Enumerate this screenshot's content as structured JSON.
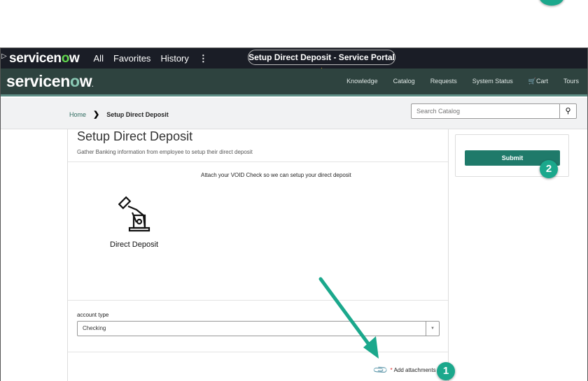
{
  "topbar": {
    "logo": "servicenow",
    "nav": [
      "All",
      "Favorites",
      "History"
    ],
    "more_icon": "vertical-dots-icon",
    "tab_title": "Setup Direct Deposit - Service Portal",
    "star_icon": "star-icon"
  },
  "portal_header": {
    "logo": "servicenow",
    "nav": [
      "Knowledge",
      "Catalog",
      "Requests",
      "System Status",
      "Cart",
      "Tours"
    ],
    "cart_icon": "cart-icon"
  },
  "breadcrumb": {
    "home": "Home",
    "current": "Setup Direct Deposit"
  },
  "search": {
    "placeholder": "Search Catalog",
    "icon": "search-icon"
  },
  "form": {
    "title": "Setup Direct Deposit",
    "description": "Gather Banking information from employee to setup their direct deposit",
    "attach_message": "Attach your VOID Check so we can setup your direct deposit",
    "image_label": "Direct Deposit",
    "account_type_label": "account type",
    "account_type_value": "Checking",
    "required_mark": "*",
    "add_attachments": "Add attachments"
  },
  "sidebar": {
    "submit": "Submit"
  },
  "annotations": {
    "badge1": "1",
    "badge2": "2",
    "color": "#1ba88c"
  }
}
